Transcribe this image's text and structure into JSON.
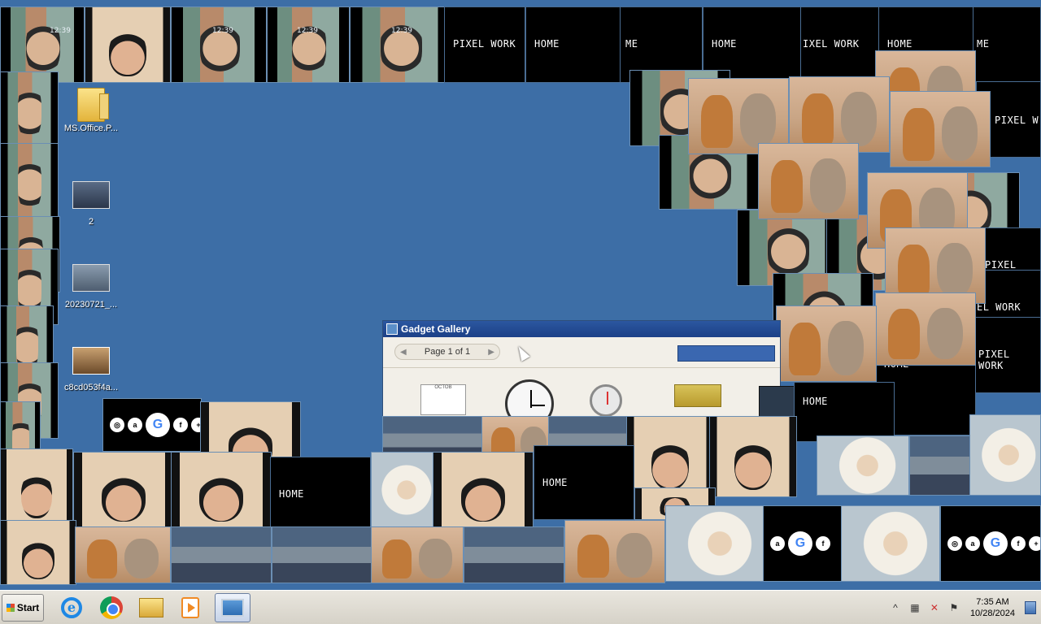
{
  "desktop": {
    "icons": [
      {
        "label": "MS.Office.P...",
        "kind": "folder"
      },
      {
        "label": "2",
        "kind": "image"
      },
      {
        "label": "20230721_...",
        "kind": "image"
      },
      {
        "label": "c8cd053f4a...",
        "kind": "video"
      }
    ],
    "tile_text": {
      "pixel_work": "PIXEL WORK",
      "home": "HOME",
      "home_partial": "ME",
      "pixel_work_partial_1": "IXEL WORK",
      "pixel_work_partial_2": "PIXEL WOR",
      "pixel_work_partial_3": "PIXEL W",
      "pixel_work_partial_4": "EL WORK",
      "time": "12:39"
    }
  },
  "gadget_gallery": {
    "title": "Gadget Gallery",
    "page_indicator": "Page 1 of 1",
    "items": [
      "calendar-gadget",
      "clock-gadget",
      "cpu-meter-gadget",
      "picture-puzzle-gadget",
      "feed-headlines-gadget"
    ],
    "calendar_label": "OCTOB"
  },
  "taskbar": {
    "start_label": "Start",
    "pinned": [
      "internet-explorer",
      "google-chrome",
      "windows-explorer",
      "media-player",
      "remote-desktop"
    ],
    "clock_time": "7:35 AM",
    "clock_date": "10/28/2024",
    "tray_overflow": "^"
  },
  "colors": {
    "desktop": "#3d6ea6",
    "taskbar": "#e0ddd5",
    "gadget_title": "#1c4087"
  }
}
